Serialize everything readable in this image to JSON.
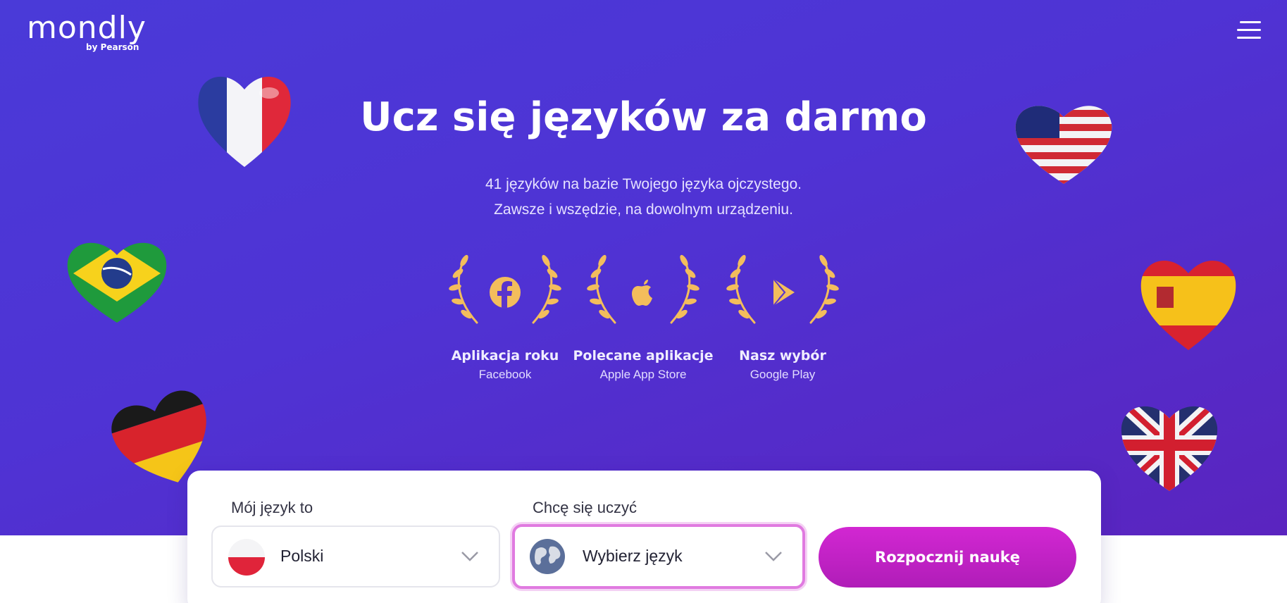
{
  "brand": {
    "name": "mondly",
    "sub": "by Pearson"
  },
  "header": {
    "menu_icon": "hamburger-menu-icon"
  },
  "hero": {
    "headline": "Ucz się języków za darmo",
    "subline": [
      "41 języków na bazie Twojego języka ojczystego.",
      "Zawsze i wszędzie, na dowolnym urządzeniu."
    ],
    "awards": [
      {
        "title": "Aplikacja roku",
        "source": "Facebook",
        "icon": "facebook-icon"
      },
      {
        "title": "Polecane aplikacje",
        "source": "Apple App Store",
        "icon": "apple-icon"
      },
      {
        "title": "Nasz wybór",
        "source": "Google Play",
        "icon": "google-play-icon"
      }
    ],
    "balloons": [
      "france-flag-balloon",
      "usa-flag-balloon",
      "brazil-flag-balloon",
      "spain-flag-balloon",
      "germany-flag-balloon",
      "uk-flag-balloon"
    ]
  },
  "form": {
    "native_label": "Mój język to",
    "native_value": "Polski",
    "target_label": "Chcę się uczyć",
    "target_placeholder": "Wybierz język",
    "cta": "Rozpocznij naukę"
  },
  "colors": {
    "hero_bg": "#4f33d4",
    "gold": "#f3bd5c",
    "cta": "#c322c9",
    "active_border": "#e07ae0"
  }
}
